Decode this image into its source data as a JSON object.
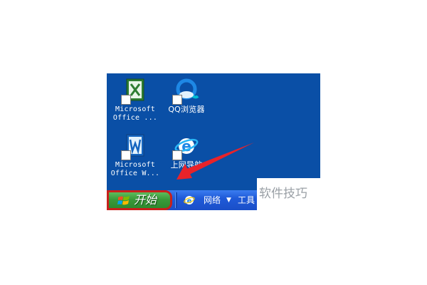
{
  "desktop": {
    "background_color": "#0a4fa6",
    "icons": [
      {
        "label": "Microsoft\nOffice ...",
        "icon": "excel-icon"
      },
      {
        "label": "QQ浏览器",
        "icon": "qq-browser-icon"
      },
      {
        "label": "Microsoft\nOffice W...",
        "icon": "word-icon"
      },
      {
        "label": "上网导航",
        "icon": "ie-icon"
      }
    ]
  },
  "taskbar": {
    "start_label": "开始",
    "start_highlight_color": "#c8201c",
    "quick_launch_icon": "ie-icon",
    "network_label": "网络",
    "network_caret": "▼",
    "tools_label": "工具"
  },
  "annotation": {
    "arrow_color": "#e8232a"
  },
  "watermark": {
    "text": "软件技巧"
  }
}
